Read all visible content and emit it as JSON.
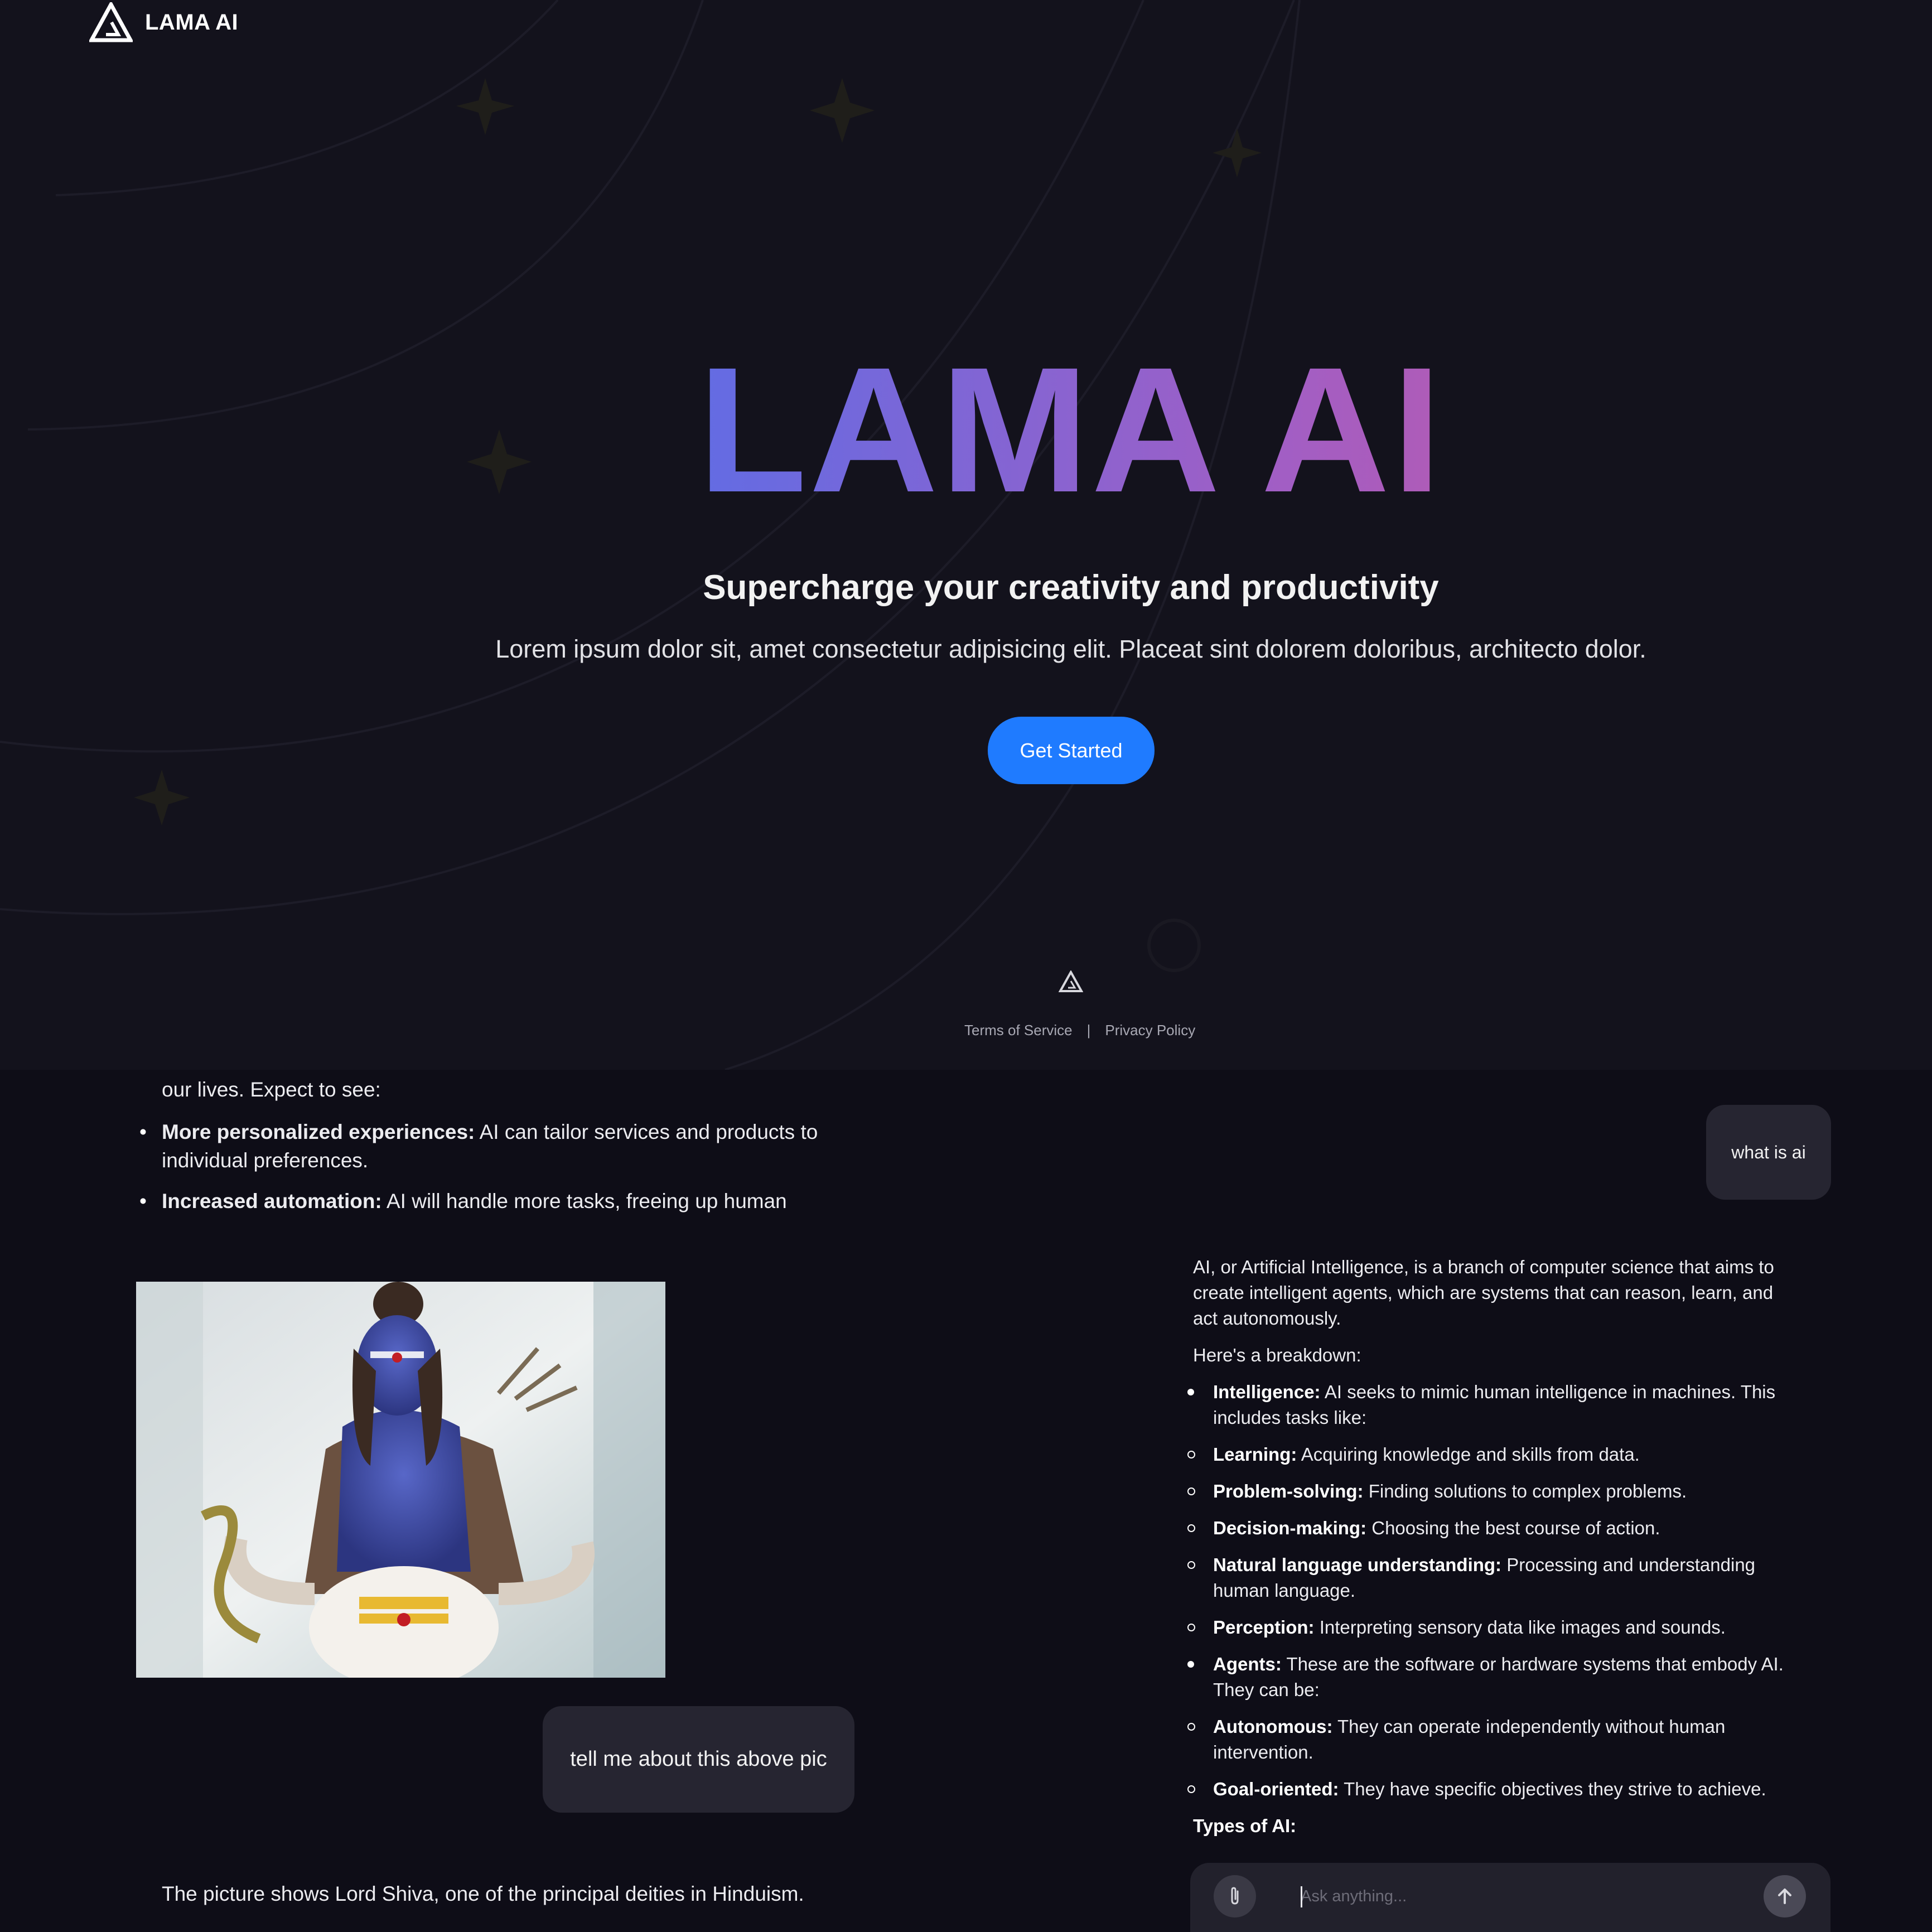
{
  "brand": {
    "name": "LAMA AI"
  },
  "hero": {
    "title": "LAMA AI",
    "subtitle": "Supercharge your creativity and productivity",
    "description": "Lorem ipsum dolor sit, amet consectetur adipisicing elit. Placeat sint dolorem doloribus, architecto dolor.",
    "cta_label": "Get Started",
    "title_gradient": [
      "#1f7bff",
      "#5d6de6",
      "#a25ec4",
      "#e84f80"
    ],
    "accent": "#1f7bff"
  },
  "footer": {
    "terms": "Terms of Service",
    "separator": "|",
    "privacy": "Privacy Policy"
  },
  "chat_left": {
    "partial_line": "our lives. Expect to see:",
    "bullets": [
      {
        "bold": "More personalized experiences:",
        "text": " AI can tailor services and products to individual preferences."
      },
      {
        "bold": "Increased automation:",
        "text": " AI will handle more tasks, freeing up human"
      }
    ],
    "image_alt": "Lord Shiva painting",
    "user_message": "tell me about this above pic",
    "ai_reply": "The picture shows Lord Shiva, one of the principal deities in Hinduism."
  },
  "chat_right": {
    "user_message": "what is ai",
    "intro": "AI, or Artificial Intelligence, is a branch of computer science that aims to create intelligent agents, which are systems that can reason, learn, and act autonomously.",
    "breakdown": "Here's a breakdown:",
    "items": [
      {
        "style": "dot",
        "bold": "Intelligence:",
        "text": " AI seeks to mimic human intelligence in machines. This includes tasks like:"
      },
      {
        "style": "ring",
        "bold": "Learning:",
        "text": " Acquiring knowledge and skills from data."
      },
      {
        "style": "ring",
        "bold": "Problem-solving:",
        "text": " Finding solutions to complex problems."
      },
      {
        "style": "ring",
        "bold": "Decision-making:",
        "text": " Choosing the best course of action."
      },
      {
        "style": "ring",
        "bold": "Natural language understanding:",
        "text": " Processing and understanding human language."
      },
      {
        "style": "ring",
        "bold": "Perception:",
        "text": " Interpreting sensory data like images and sounds."
      },
      {
        "style": "dot",
        "bold": "Agents:",
        "text": " These are the software or hardware systems that embody AI. They can be:"
      },
      {
        "style": "ring",
        "bold": "Autonomous:",
        "text": " They can operate independently without human intervention."
      },
      {
        "style": "ring",
        "bold": "Goal-oriented:",
        "text": " They have specific objectives they strive to achieve."
      }
    ],
    "types_heading": "Types of AI:"
  },
  "input_bar": {
    "placeholder": "Ask anything...",
    "attach_icon": "paperclip-icon",
    "send_icon": "arrow-up-icon"
  }
}
